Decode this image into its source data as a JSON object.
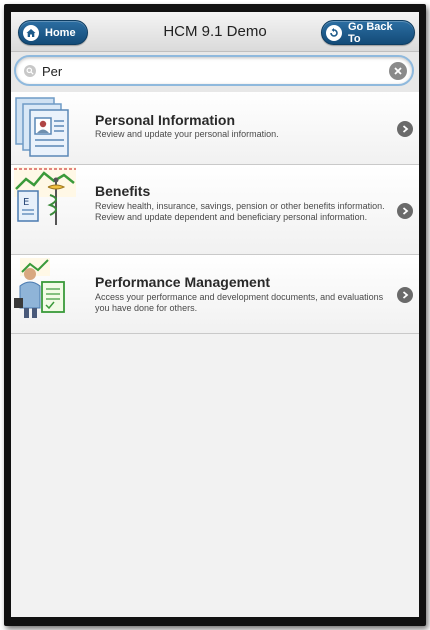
{
  "header": {
    "title": "HCM 9.1 Demo",
    "home_label": "Home",
    "back_label": "Go Back To"
  },
  "search": {
    "value": "Per",
    "placeholder": ""
  },
  "items": [
    {
      "title": "Personal Information",
      "description": "Review and update your personal information.",
      "icon": "personal-information-icon"
    },
    {
      "title": "Benefits",
      "description": "Review health, insurance, savings, pension or other benefits information. Review and update dependent and beneficiary personal information.",
      "icon": "benefits-icon"
    },
    {
      "title": "Performance Management",
      "description": "Access your performance and development documents, and evaluations you have done for others.",
      "icon": "performance-management-icon"
    }
  ],
  "colors": {
    "button_blue": "#1f5d8e",
    "search_border": "#8fb9dd"
  }
}
